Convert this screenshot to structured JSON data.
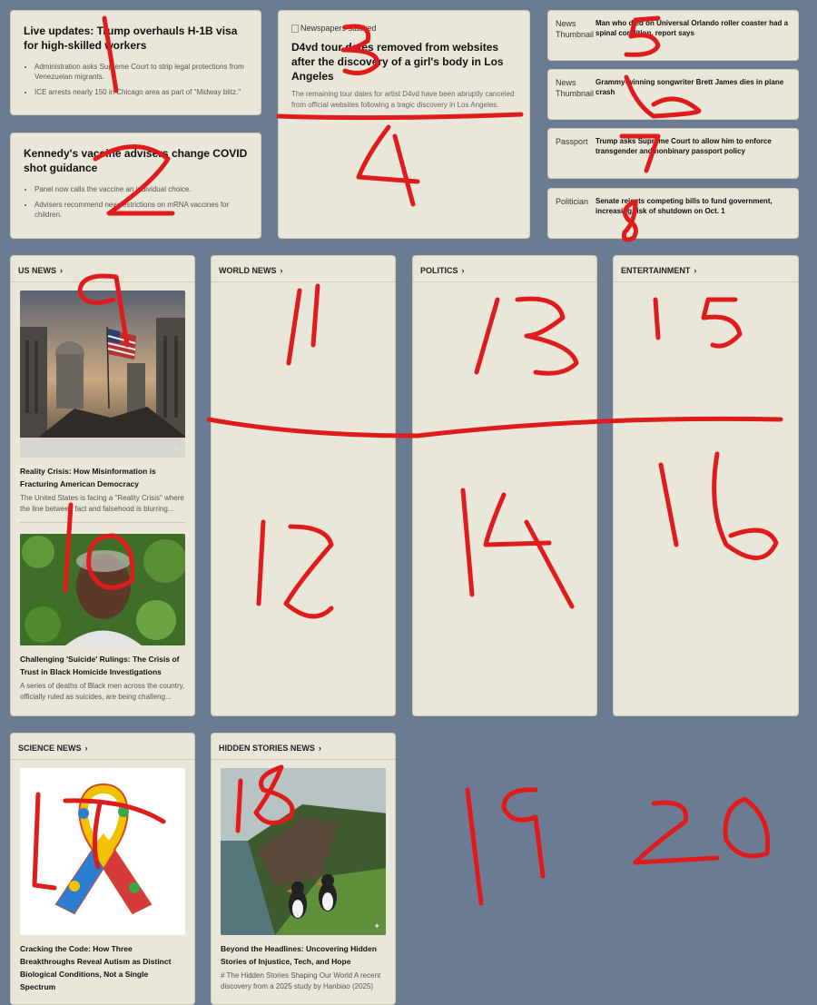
{
  "top_left": [
    {
      "headline": "Live updates: Trump overhauls H-1B visa for high-skilled workers",
      "bullets": [
        "Administration asks Supreme Court to strip legal protections from Venezuelan migrants.",
        "ICE arrests nearly 150 in Chicago area as part of \"Midway blitz.\""
      ]
    },
    {
      "headline": "Kennedy's vaccine advisers change COVID shot guidance",
      "bullets": [
        "Panel now calls the vaccine an individual choice.",
        "Advisers recommend new restrictions on mRNA vaccines for children."
      ]
    }
  ],
  "featured": {
    "image_alt": "Newspapers stacked",
    "headline": "D4vd tour dates removed from websites after the discovery of a girl's body in Los Angeles",
    "summary": "The remaining tour dates for artist D4vd have been abruptly canceled from official websites following a tragic discovery in Los Angeles."
  },
  "small_stories": [
    {
      "thumb_alt": "News Thumbnail",
      "title": "Man who died on Universal Orlando roller coaster had a spinal condition, report says"
    },
    {
      "thumb_alt": "News Thumbnail",
      "title": "Grammy-winning songwriter Brett James dies in plane crash"
    },
    {
      "thumb_alt": "Passport",
      "title": "Trump asks Supreme Court to allow him to enforce transgender and nonbinary passport policy"
    },
    {
      "thumb_alt": "Politician",
      "title": "Senate rejects competing bills to fund government, increasing risk of shutdown on Oct. 1"
    }
  ],
  "sections": {
    "us_news": {
      "title": "US NEWS",
      "articles": [
        {
          "title": "Reality Crisis: How Misinformation is Fracturing American Democracy",
          "summary": "The United States is facing a \"Reality Crisis\" where the line between fact and falsehood is blurring..."
        },
        {
          "title": "Challenging 'Suicide' Rulings: The Crisis of Trust in Black Homicide Investigations",
          "summary": "A series of deaths of Black men across the country, officially ruled as suicides, are being challeng..."
        }
      ]
    },
    "world_news": {
      "title": "WORLD NEWS"
    },
    "politics": {
      "title": "POLITICS"
    },
    "entertainment": {
      "title": "ENTERTAINMENT"
    },
    "science_news": {
      "title": "SCIENCE NEWS",
      "articles": [
        {
          "title": "Cracking the Code: How Three Breakthroughs Reveal Autism as Distinct Biological Conditions, Not a Single Spectrum",
          "summary": ""
        }
      ]
    },
    "hidden_stories": {
      "title": "HIDDEN STORIES NEWS",
      "articles": [
        {
          "title": "Beyond the Headlines: Uncovering Hidden Stories of Injustice, Tech, and Hope",
          "summary": "# The Hidden Stories Shaping Our World A recent discovery from a 2025 study by Hanbiao (2025)"
        }
      ]
    }
  },
  "annotations": [
    "1",
    "2",
    "3",
    "4",
    "5",
    "6",
    "7",
    "8",
    "9",
    "10",
    "11",
    "12",
    "13",
    "14",
    "15",
    "16",
    "17",
    "18",
    "19",
    "20"
  ],
  "colors": {
    "background": "#6b7b91",
    "card": "#e9e6da",
    "marker": "#e01b1b"
  }
}
